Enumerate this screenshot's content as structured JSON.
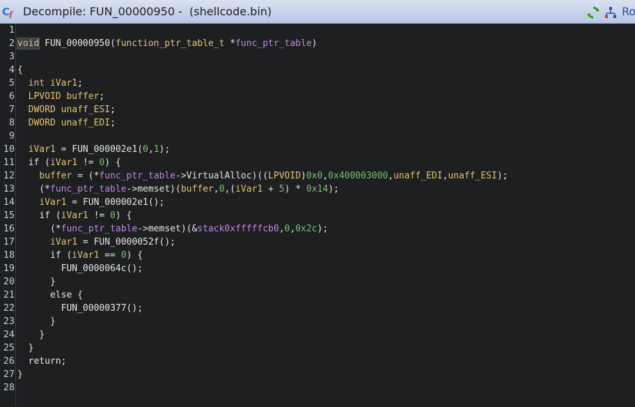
{
  "window": {
    "title": "Decompile: FUN_00000950 -  (shellcode.bin)",
    "truncated_text": "Ro",
    "icons": {
      "title_icon": "decompiler-icon",
      "refresh": "refresh-icon",
      "graph": "function-graph-icon"
    }
  },
  "colors": {
    "background": "#1d1f21",
    "type": "#e8c271",
    "variable": "#e6c46c",
    "parameter": "#c586e0",
    "number": "#7ec16e",
    "text": "#e4e4e4"
  },
  "code": {
    "line_numbers": [
      "1",
      "2",
      "3",
      "4",
      "5",
      "6",
      "7",
      "8",
      "9",
      "10",
      "11",
      "12",
      "13",
      "14",
      "15",
      "16",
      "17",
      "18",
      "19",
      "20",
      "21",
      "22",
      "23",
      "24",
      "25",
      "26",
      "27",
      "28"
    ],
    "lines": [
      [],
      [
        [
          "void",
          "type hl"
        ],
        [
          " ",
          "plain"
        ],
        [
          "FUN_00000950",
          "fn"
        ],
        [
          "(",
          "plain"
        ],
        [
          "function_ptr_table_t",
          "type"
        ],
        [
          " *",
          "plain"
        ],
        [
          "func_ptr_table",
          "param"
        ],
        [
          ")",
          "plain"
        ]
      ],
      [],
      [
        [
          "{",
          "plain"
        ]
      ],
      [
        [
          "  ",
          "plain"
        ],
        [
          "int",
          "type"
        ],
        [
          " ",
          "plain"
        ],
        [
          "iVar1",
          "var"
        ],
        [
          ";",
          "plain"
        ]
      ],
      [
        [
          "  ",
          "plain"
        ],
        [
          "LPVOID",
          "type"
        ],
        [
          " ",
          "plain"
        ],
        [
          "buffer",
          "var"
        ],
        [
          ";",
          "plain"
        ]
      ],
      [
        [
          "  ",
          "plain"
        ],
        [
          "DWORD",
          "type"
        ],
        [
          " ",
          "plain"
        ],
        [
          "unaff_ESI",
          "var"
        ],
        [
          ";",
          "plain"
        ]
      ],
      [
        [
          "  ",
          "plain"
        ],
        [
          "DWORD",
          "type"
        ],
        [
          " ",
          "plain"
        ],
        [
          "unaff_EDI",
          "var"
        ],
        [
          ";",
          "plain"
        ]
      ],
      [],
      [
        [
          "  ",
          "plain"
        ],
        [
          "iVar1",
          "var"
        ],
        [
          " = ",
          "plain"
        ],
        [
          "FUN_000002e1",
          "fn"
        ],
        [
          "(",
          "plain"
        ],
        [
          "0",
          "num"
        ],
        [
          ",",
          "plain"
        ],
        [
          "1",
          "num"
        ],
        [
          ");",
          "plain"
        ]
      ],
      [
        [
          "  ",
          "plain"
        ],
        [
          "if",
          "kw"
        ],
        [
          " (",
          "plain"
        ],
        [
          "iVar1",
          "var"
        ],
        [
          " != ",
          "plain"
        ],
        [
          "0",
          "num"
        ],
        [
          ") {",
          "plain"
        ]
      ],
      [
        [
          "    ",
          "plain"
        ],
        [
          "buffer",
          "var"
        ],
        [
          " = (*",
          "plain"
        ],
        [
          "func_ptr_table",
          "param"
        ],
        [
          "->VirtualAlloc)((",
          "plain"
        ],
        [
          "LPVOID",
          "type"
        ],
        [
          ")",
          "plain"
        ],
        [
          "0x0",
          "num"
        ],
        [
          ",",
          "plain"
        ],
        [
          "0x400003000",
          "num"
        ],
        [
          ",",
          "plain"
        ],
        [
          "unaff_EDI",
          "var"
        ],
        [
          ",",
          "plain"
        ],
        [
          "unaff_ESI",
          "var"
        ],
        [
          ");",
          "plain"
        ]
      ],
      [
        [
          "    (*",
          "plain"
        ],
        [
          "func_ptr_table",
          "param"
        ],
        [
          "->memset)(",
          "plain"
        ],
        [
          "buffer",
          "var"
        ],
        [
          ",",
          "plain"
        ],
        [
          "0",
          "num"
        ],
        [
          ",(",
          "plain"
        ],
        [
          "iVar1",
          "var"
        ],
        [
          " + ",
          "plain"
        ],
        [
          "5",
          "num"
        ],
        [
          ") * ",
          "plain"
        ],
        [
          "0x14",
          "num"
        ],
        [
          ");",
          "plain"
        ]
      ],
      [
        [
          "    ",
          "plain"
        ],
        [
          "iVar1",
          "var"
        ],
        [
          " = ",
          "plain"
        ],
        [
          "FUN_000002e1",
          "fn"
        ],
        [
          "();",
          "plain"
        ]
      ],
      [
        [
          "    ",
          "plain"
        ],
        [
          "if",
          "kw"
        ],
        [
          " (",
          "plain"
        ],
        [
          "iVar1",
          "var"
        ],
        [
          " != ",
          "plain"
        ],
        [
          "0",
          "num"
        ],
        [
          ") {",
          "plain"
        ]
      ],
      [
        [
          "      (*",
          "plain"
        ],
        [
          "func_ptr_table",
          "param"
        ],
        [
          "->memset)(&",
          "plain"
        ],
        [
          "stack0xfffffcb0",
          "glob"
        ],
        [
          ",",
          "plain"
        ],
        [
          "0",
          "num"
        ],
        [
          ",",
          "plain"
        ],
        [
          "0x2c",
          "num"
        ],
        [
          ");",
          "plain"
        ]
      ],
      [
        [
          "      ",
          "plain"
        ],
        [
          "iVar1",
          "var"
        ],
        [
          " = ",
          "plain"
        ],
        [
          "FUN_0000052f",
          "fn"
        ],
        [
          "();",
          "plain"
        ]
      ],
      [
        [
          "      ",
          "plain"
        ],
        [
          "if",
          "kw"
        ],
        [
          " (",
          "plain"
        ],
        [
          "iVar1",
          "var"
        ],
        [
          " == ",
          "plain"
        ],
        [
          "0",
          "num"
        ],
        [
          ") {",
          "plain"
        ]
      ],
      [
        [
          "        ",
          "plain"
        ],
        [
          "FUN_0000064c",
          "fn"
        ],
        [
          "();",
          "plain"
        ]
      ],
      [
        [
          "      }",
          "plain"
        ]
      ],
      [
        [
          "      ",
          "plain"
        ],
        [
          "else",
          "kw"
        ],
        [
          " {",
          "plain"
        ]
      ],
      [
        [
          "        ",
          "plain"
        ],
        [
          "FUN_00000377",
          "fn"
        ],
        [
          "();",
          "plain"
        ]
      ],
      [
        [
          "      }",
          "plain"
        ]
      ],
      [
        [
          "    }",
          "plain"
        ]
      ],
      [
        [
          "  }",
          "plain"
        ]
      ],
      [
        [
          "  ",
          "plain"
        ],
        [
          "return",
          "kw"
        ],
        [
          ";",
          "plain"
        ]
      ],
      [
        [
          "}",
          "plain"
        ]
      ],
      []
    ]
  }
}
